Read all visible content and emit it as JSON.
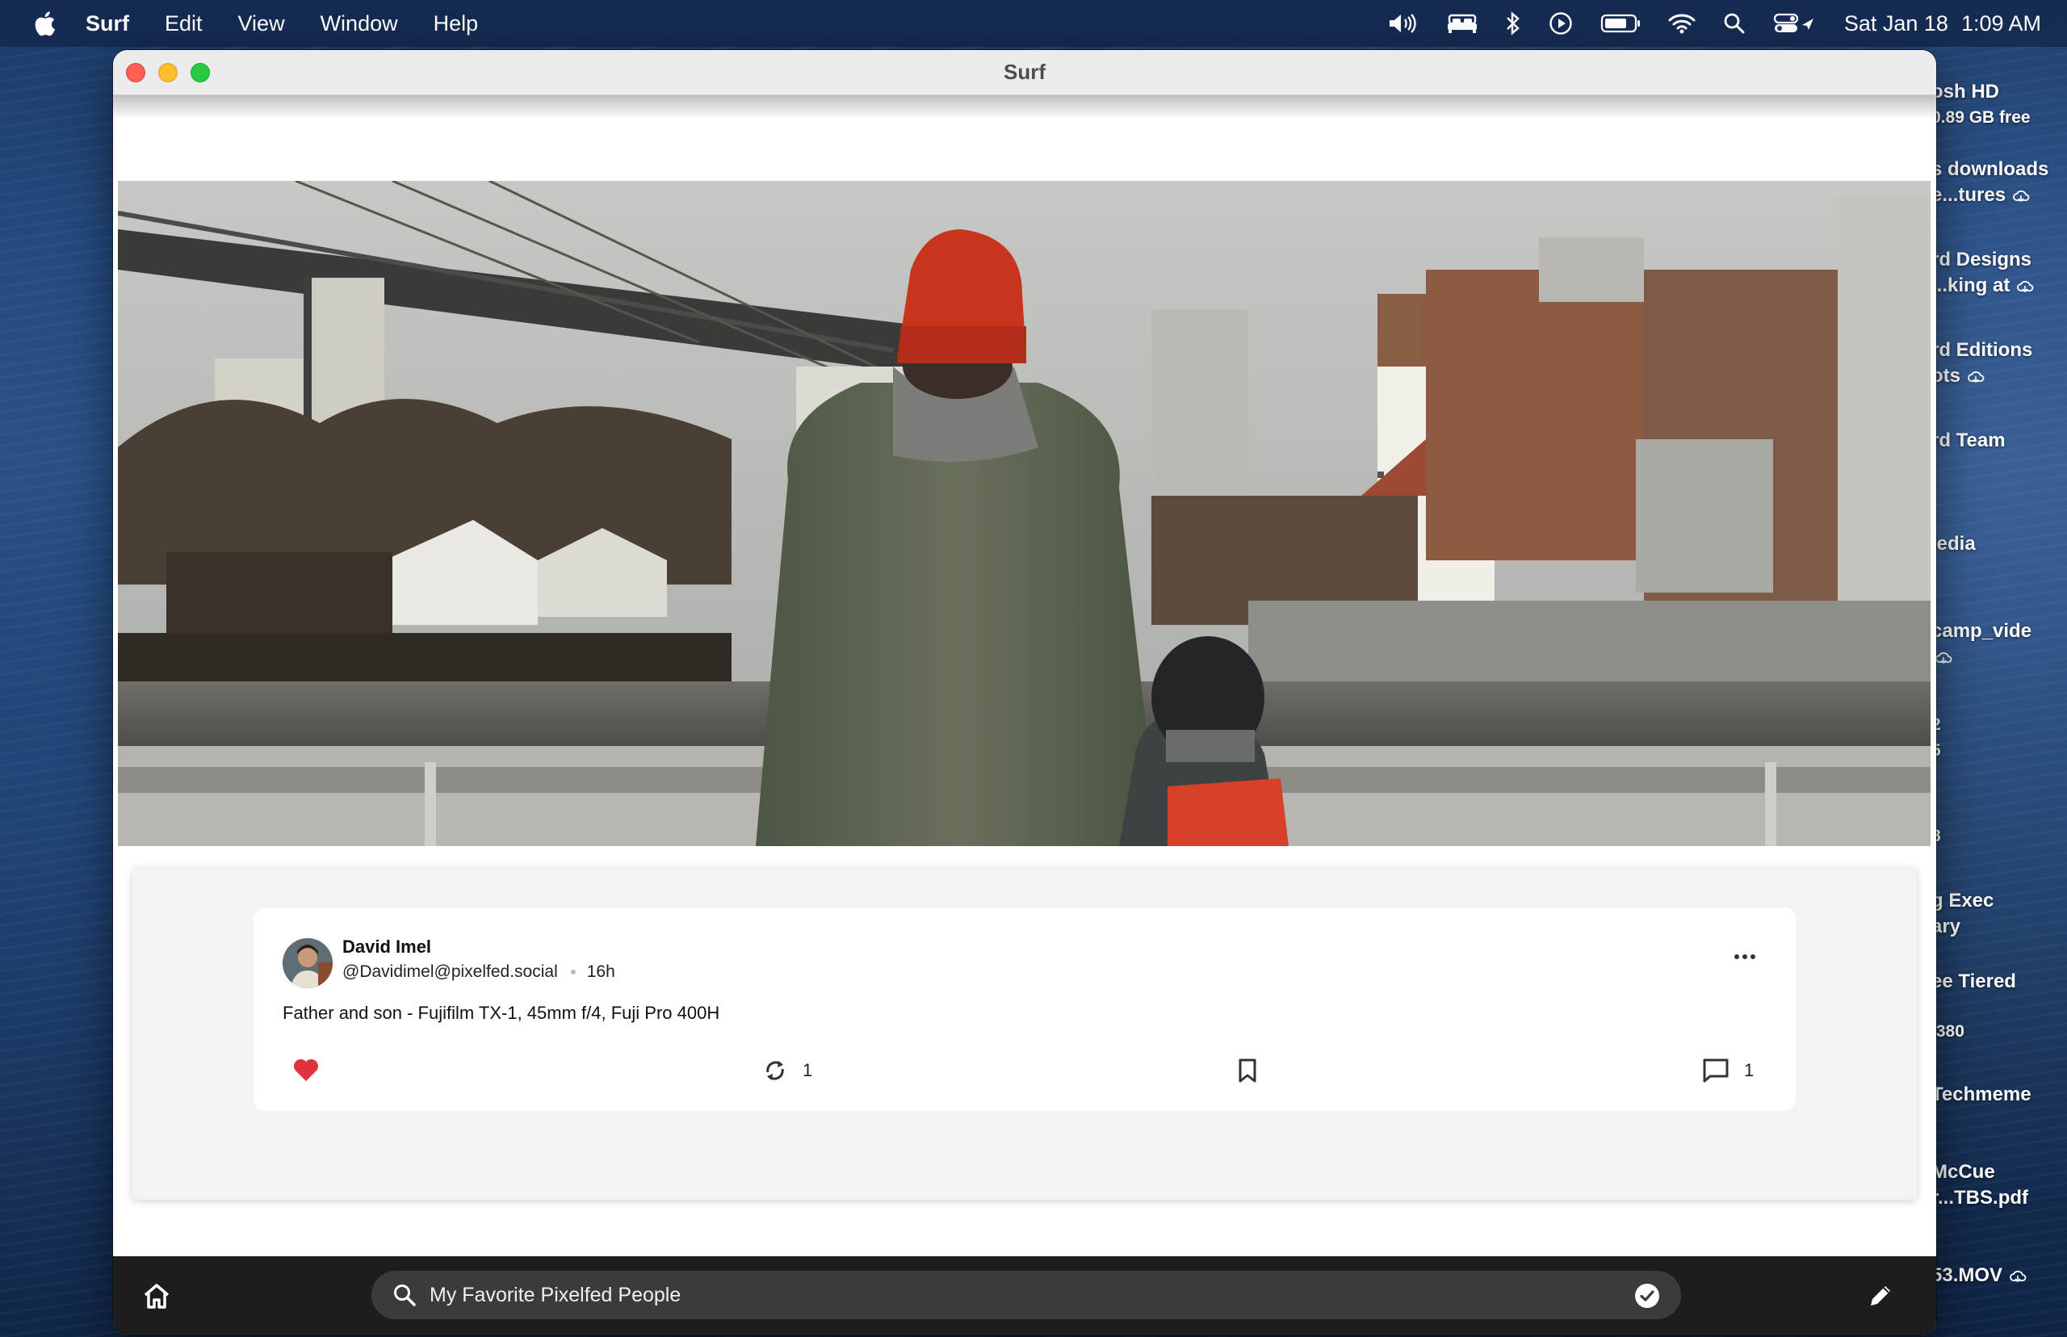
{
  "menubar": {
    "app_name": "Surf",
    "items": [
      "Edit",
      "View",
      "Window",
      "Help"
    ],
    "date": "Sat Jan 18",
    "time": "1:09 AM"
  },
  "desktop": {
    "items": [
      {
        "line1": "osh HD",
        "line2": "0.89 GB free"
      },
      {
        "line1": "s downloads",
        "line2": "e...tures"
      },
      {
        "line1": "rd Designs",
        "line2": "...king at"
      },
      {
        "line1": "rd Editions",
        "line2": "ots"
      },
      {
        "line1": "rd Team",
        "line2": ""
      },
      {
        "line1": "ledia",
        "line2": ""
      },
      {
        "line1": "camp_vide",
        "line2": ""
      },
      {
        "line1": "2",
        "line2": "5"
      },
      {
        "line1": "8",
        "line2": ""
      },
      {
        "line1": "g Exec",
        "line2": "ary"
      },
      {
        "line1": "ee Tiered",
        "line2": ""
      },
      {
        "line1": ",380",
        "line2": ""
      },
      {
        "line1": " Techmeme",
        "line2": ""
      },
      {
        "line1": "McCue",
        "line2": "r...TBS.pdf"
      },
      {
        "line1": "53.MOV",
        "line2": ""
      }
    ]
  },
  "window": {
    "title": "Surf"
  },
  "post": {
    "author_name": "David Imel",
    "author_handle": "@Davidimel@pixelfed.social",
    "time_ago": "16h",
    "text": "Father and son - Fujifilm TX-1, 45mm f/4, Fuji Pro 400H",
    "liked": true,
    "boost_count": "1",
    "reply_count": "1",
    "colors": {
      "like": "#e0323e"
    }
  },
  "bottombar": {
    "search_text": "My Favorite Pixelfed People"
  }
}
